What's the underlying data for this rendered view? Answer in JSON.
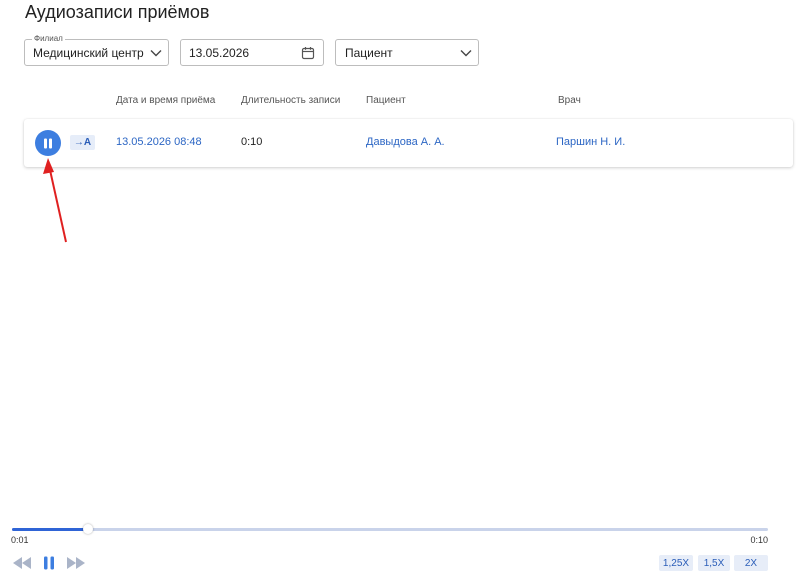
{
  "title": "Аудиозаписи приёмов",
  "filters": {
    "branch": {
      "label": "Филиал",
      "value": "Медицинский центр ..."
    },
    "date": {
      "value": "13.05.2026"
    },
    "patient": {
      "placeholder": "Пациент"
    }
  },
  "table": {
    "columns": [
      "Дата и время приёма",
      "Длительность записи",
      "Пациент",
      "Врач"
    ],
    "rows": [
      {
        "transcribe_label": "→A",
        "datetime": "13.05.2026 08:48",
        "duration": "0:10",
        "patient": "Давыдова А. А.",
        "doctor": "Паршин Н. И."
      }
    ]
  },
  "player": {
    "current_time": "0:01",
    "total_time": "0:10",
    "progress_fraction": 0.1,
    "speeds": [
      "1,25X",
      "1,5X",
      "2X"
    ]
  },
  "colors": {
    "accent": "#3d7ee0",
    "link": "#2c66c4",
    "annotation": "#e02020"
  },
  "icons": {
    "row_play": "pause-icon",
    "rewind": "rewind-icon",
    "play": "pause-icon",
    "forward": "fast-forward-icon"
  }
}
